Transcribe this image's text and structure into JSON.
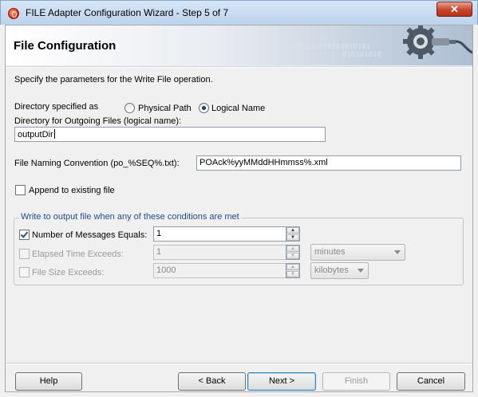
{
  "window": {
    "title": "FILE Adapter Configuration Wizard - Step 5 of 7",
    "close_glyph": "✕"
  },
  "header": {
    "title": "File Configuration",
    "binary_decor": [
      "0101010101010101010101",
      "010101010"
    ],
    "icon": "gear-connector-icon"
  },
  "description": "Specify the parameters for the Write File operation.",
  "directory": {
    "label": "Directory specified as",
    "options": [
      {
        "label": "Physical Path",
        "selected": false
      },
      {
        "label": "Logical Name",
        "selected": true
      }
    ],
    "outgoing_label": "Directory for Outgoing Files (logical name):",
    "outgoing_value": "outputDir"
  },
  "naming": {
    "label": "File Naming Convention (po_%SEQ%.txt):",
    "value": "POAck%yyMMddHHmmss%.xml"
  },
  "append": {
    "label": "Append to existing file",
    "checked": false
  },
  "conditions": {
    "legend": "Write to output file when any of these conditions are met",
    "number_of_messages": {
      "label": "Number of Messages Equals:",
      "value": "1",
      "checked": true
    },
    "elapsed_time": {
      "label": "Elapsed Time Exceeds:",
      "value": "1",
      "unit": "minutes",
      "checked": false
    },
    "file_size": {
      "label": "File Size Exceeds:",
      "value": "1000",
      "unit": "kilobytes",
      "checked": false
    }
  },
  "buttons": {
    "help": "Help",
    "back": "< Back",
    "next": "Next >",
    "finish": "Finish",
    "cancel": "Cancel"
  }
}
